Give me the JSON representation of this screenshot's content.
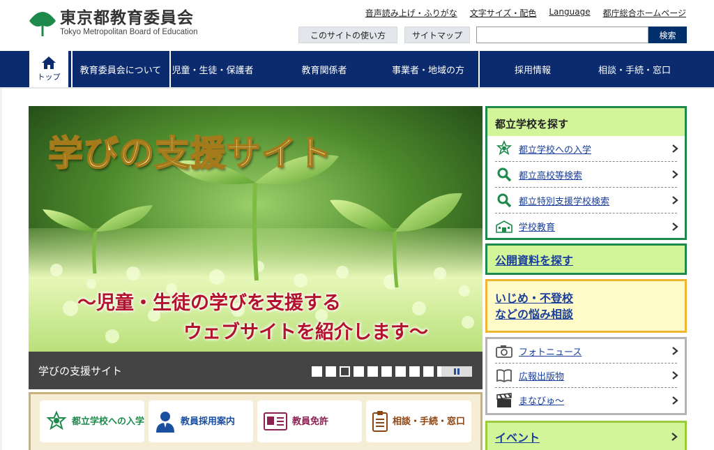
{
  "header": {
    "logo_ja": "東京都教育委員会",
    "logo_en": "Tokyo Metropolitan Board of Education",
    "util_links": [
      "音声読み上げ・ふりがな",
      "文字サイズ・配色",
      "Language",
      "都庁総合ホームページ"
    ],
    "help_buttons": [
      "このサイトの使い方",
      "サイトマップ"
    ],
    "search_value": "",
    "search_button": "検索"
  },
  "gnav": {
    "home": "トップ",
    "items": [
      "教育委員会について",
      "児童・生徒・保護者",
      "教育関係者",
      "事業者・地域の方",
      "採用情報",
      "相談・手続・窓口"
    ]
  },
  "hero": {
    "title": "学びの支援サイト",
    "subtitle_line1": "～児童・生徒の学びを支援する",
    "subtitle_line2": "ウェブサイトを紹介します～",
    "caption": "学びの支援サイト",
    "slide_count": 10,
    "active_slide": 3
  },
  "quick_links": [
    {
      "label": "都立学校への入学",
      "color": "#1d8a4b",
      "icon": "school-flower-icon"
    },
    {
      "label": "教員採用案内",
      "color": "#1a4fa0",
      "icon": "person-icon"
    },
    {
      "label": "教員免許",
      "color": "#8b2252",
      "icon": "id-card-icon"
    },
    {
      "label": "相談・手続・窓口",
      "color": "#8b4513",
      "icon": "clipboard-icon"
    }
  ],
  "sidebar": {
    "school_header": "都立学校を探す",
    "school_items": [
      {
        "label": "都立学校への入学",
        "icon": "school-flower-icon"
      },
      {
        "label": "都立高校等検索",
        "icon": "search-icon"
      },
      {
        "label": "都立特別支援学校検索",
        "icon": "search-icon"
      },
      {
        "label": "学校教育",
        "icon": "school-building-icon"
      }
    ],
    "docs": "公開資料を探す",
    "bully_line1": "いじめ・不登校",
    "bully_line2": "などの悩み相談",
    "news_items": [
      {
        "label": "フォトニュース",
        "icon": "camera-icon"
      },
      {
        "label": "広報出版物",
        "icon": "book-icon"
      },
      {
        "label": "まなびゅ～",
        "icon": "clapperboard-icon"
      }
    ],
    "event": "イベント"
  },
  "colors": {
    "navy": "#0b2b6e",
    "green": "#1d8a4b",
    "light_green": "#d2f59a",
    "yellow_border": "#f0b632",
    "link_blue": "#1a3e9c"
  }
}
